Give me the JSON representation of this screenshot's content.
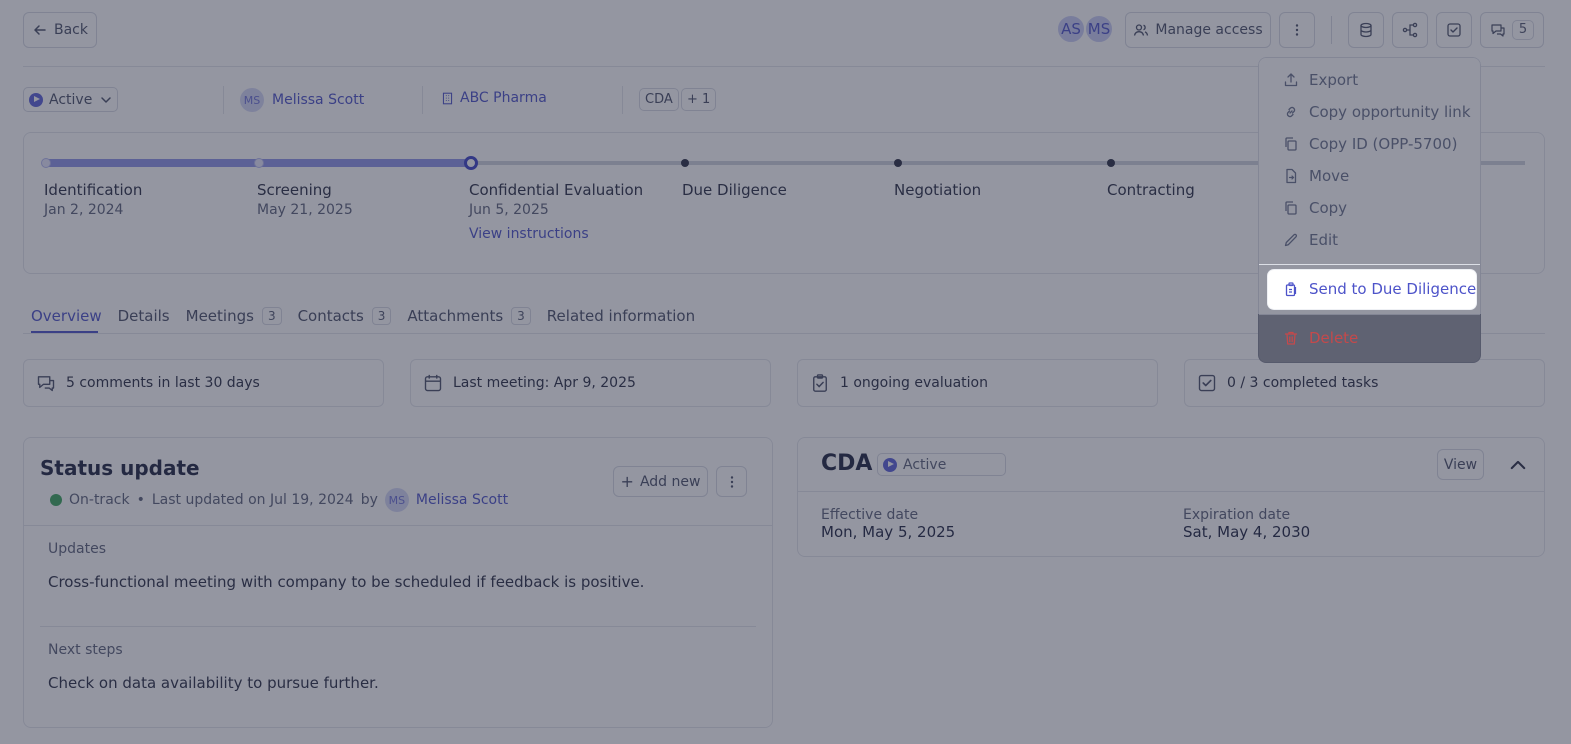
{
  "header": {
    "back_label": "Back",
    "avatars": [
      "AS",
      "MS"
    ],
    "manage_access_label": "Manage access",
    "comments_count": "5"
  },
  "meta": {
    "status": "Active",
    "owner_initials": "MS",
    "owner_name": "Melissa Scott",
    "company": "ABC Pharma",
    "tag": "CDA",
    "tag_extra": "+ 1"
  },
  "stages": [
    {
      "name": "Identification",
      "date": "Jan 2, 2024"
    },
    {
      "name": "Screening",
      "date": "May 21, 2025"
    },
    {
      "name": "Confidential Evaluation",
      "date": "Jun 5, 2025",
      "link": "View instructions"
    },
    {
      "name": "Due Diligence"
    },
    {
      "name": "Negotiation"
    },
    {
      "name": "Contracting"
    }
  ],
  "tabs": [
    {
      "label": "Overview"
    },
    {
      "label": "Details"
    },
    {
      "label": "Meetings",
      "count": "3"
    },
    {
      "label": "Contacts",
      "count": "3"
    },
    {
      "label": "Attachments",
      "count": "3"
    },
    {
      "label": "Related information"
    }
  ],
  "summary": [
    {
      "icon": "comments-icon",
      "text": "5 comments in last 30 days"
    },
    {
      "icon": "calendar-icon",
      "text": "Last meeting: Apr 9, 2025"
    },
    {
      "icon": "clipboard-check-icon",
      "text": "1 ongoing evaluation"
    },
    {
      "icon": "checkbox-icon",
      "text": "0 / 3 completed tasks"
    }
  ],
  "status_update": {
    "title": "Status update",
    "health": "On-track",
    "bullet": "•",
    "updated": "Last updated on Jul 19, 2024",
    "by": "by",
    "author_initials": "MS",
    "author": "Melissa Scott",
    "add_new_label": "Add new",
    "updates_label": "Updates",
    "updates_text": "Cross-functional meeting with company to be scheduled if feedback is positive.",
    "next_steps_label": "Next steps",
    "next_steps_text": "Check on data availability to pursue further."
  },
  "cda": {
    "title": "CDA",
    "status": "Active",
    "view_label": "View",
    "effective_label": "Effective date",
    "effective_value": "Mon, May 5, 2025",
    "expiration_label": "Expiration date",
    "expiration_value": "Sat, May 4, 2030"
  },
  "menu": {
    "export": "Export",
    "copy_link": "Copy opportunity link",
    "copy_id": "Copy ID (OPP-5700)",
    "move": "Move",
    "copy": "Copy",
    "edit": "Edit",
    "send": "Send to Due Diligence",
    "delete": "Delete"
  },
  "colors": {
    "accent": "#4d53c9",
    "danger": "#d64545",
    "on_track": "#3aa55d"
  }
}
